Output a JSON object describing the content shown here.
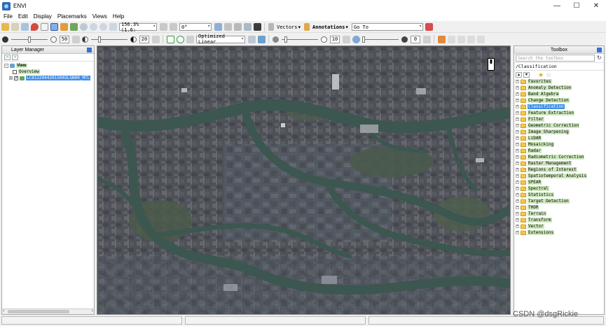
{
  "window": {
    "title": "ENVI",
    "controls": [
      "—",
      "☐",
      "✕"
    ]
  },
  "menu": [
    "File",
    "Edit",
    "Display",
    "Placemarks",
    "Views",
    "Help"
  ],
  "toolbar1": {
    "zoom_value": "156.3% (1.6:",
    "rotation_value": "0°",
    "vectors_label": "Vectors",
    "annotations_label": "Annotations",
    "goto_value": "Go To"
  },
  "toolbar2": {
    "brightness_value": "50",
    "contrast_value": "20",
    "stretch_value": "Optimized Linear",
    "sharpen_value": "10",
    "transparency_value": "0"
  },
  "layer_manager": {
    "title": "Layer Manager",
    "root_label": "View",
    "items": [
      {
        "label": "Overview",
        "checked": false
      },
      {
        "label": "LC81220442015003LGN00_MTL",
        "checked": true
      }
    ]
  },
  "toolbox": {
    "title": "Toolbox",
    "search_placeholder": "Search the toolbox",
    "path": "/Classification",
    "items": [
      "Favorites",
      "Anomaly Detection",
      "Band Algebra",
      "Change Detection",
      "Classification",
      "Feature Extraction",
      "Filter",
      "Geometric Correction",
      "Image Sharpening",
      "LiDAR",
      "Mosaicking",
      "Radar",
      "Radiometric Correction",
      "Raster Management",
      "Regions of Interest",
      "Spatiotemporal Analysis",
      "SPEAR",
      "Spectral",
      "Statistics",
      "Target Detection",
      "THOR",
      "Terrain",
      "Transform",
      "Vector",
      "Extensions"
    ],
    "selected_item": "Classification"
  },
  "watermark": "CSDN @dsgRickie",
  "colors": {
    "selection": "#3d8ee8",
    "label_highlight": "#cde8bd",
    "folder": "#f0c94a",
    "river": "#3c5650"
  }
}
